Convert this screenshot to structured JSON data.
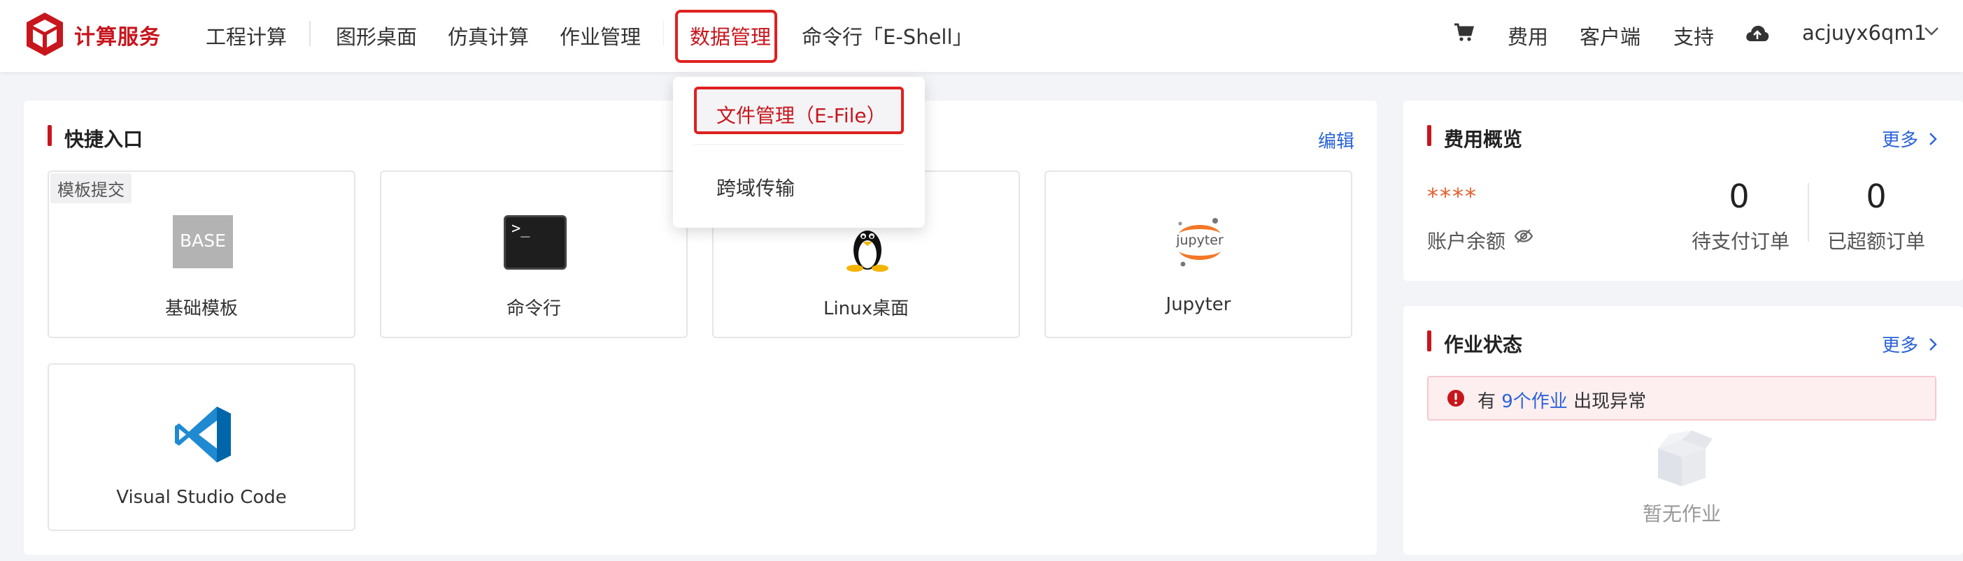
{
  "brand": {
    "name": "计算服务"
  },
  "nav": {
    "items": [
      {
        "label": "工程计算"
      },
      {
        "label": "图形桌面"
      },
      {
        "label": "仿真计算"
      },
      {
        "label": "作业管理"
      },
      {
        "label": "数据管理"
      },
      {
        "label": "命令行「E-Shell」"
      }
    ],
    "right": {
      "fee": "费用",
      "client": "客户端",
      "support": "支持",
      "user": "acjuyx6qm1"
    }
  },
  "dropdown": {
    "items": [
      {
        "label": "文件管理（E-File）"
      },
      {
        "label": "跨域传输"
      }
    ]
  },
  "quick_entry": {
    "title": "快捷入口",
    "edit_label": "编辑",
    "tiles": [
      {
        "label": "基础模板",
        "tag": "模板提交",
        "icon_text": "BASE"
      },
      {
        "label": "命令行",
        "icon_text": ">_"
      },
      {
        "label": "Linux桌面"
      },
      {
        "label": "Jupyter",
        "icon_text": "jupyter"
      },
      {
        "label": "Visual Studio Code"
      }
    ]
  },
  "fee_overview": {
    "title": "费用概览",
    "more_label": "更多",
    "balance_masked": "****",
    "balance_label": "账户余额",
    "pending_orders": {
      "value": "0",
      "label": "待支付订单"
    },
    "overdue_orders": {
      "value": "0",
      "label": "已超额订单"
    }
  },
  "job_status": {
    "title": "作业状态",
    "more_label": "更多",
    "alert": {
      "prefix": "有 ",
      "link": "9个作业",
      "suffix": " 出现异常"
    },
    "empty_text": "暂无作业"
  },
  "colors": {
    "brand_red": "#c8161d",
    "link_blue": "#2b63d8",
    "highlight_red": "#e02020",
    "balance_orange": "#e5602c"
  }
}
